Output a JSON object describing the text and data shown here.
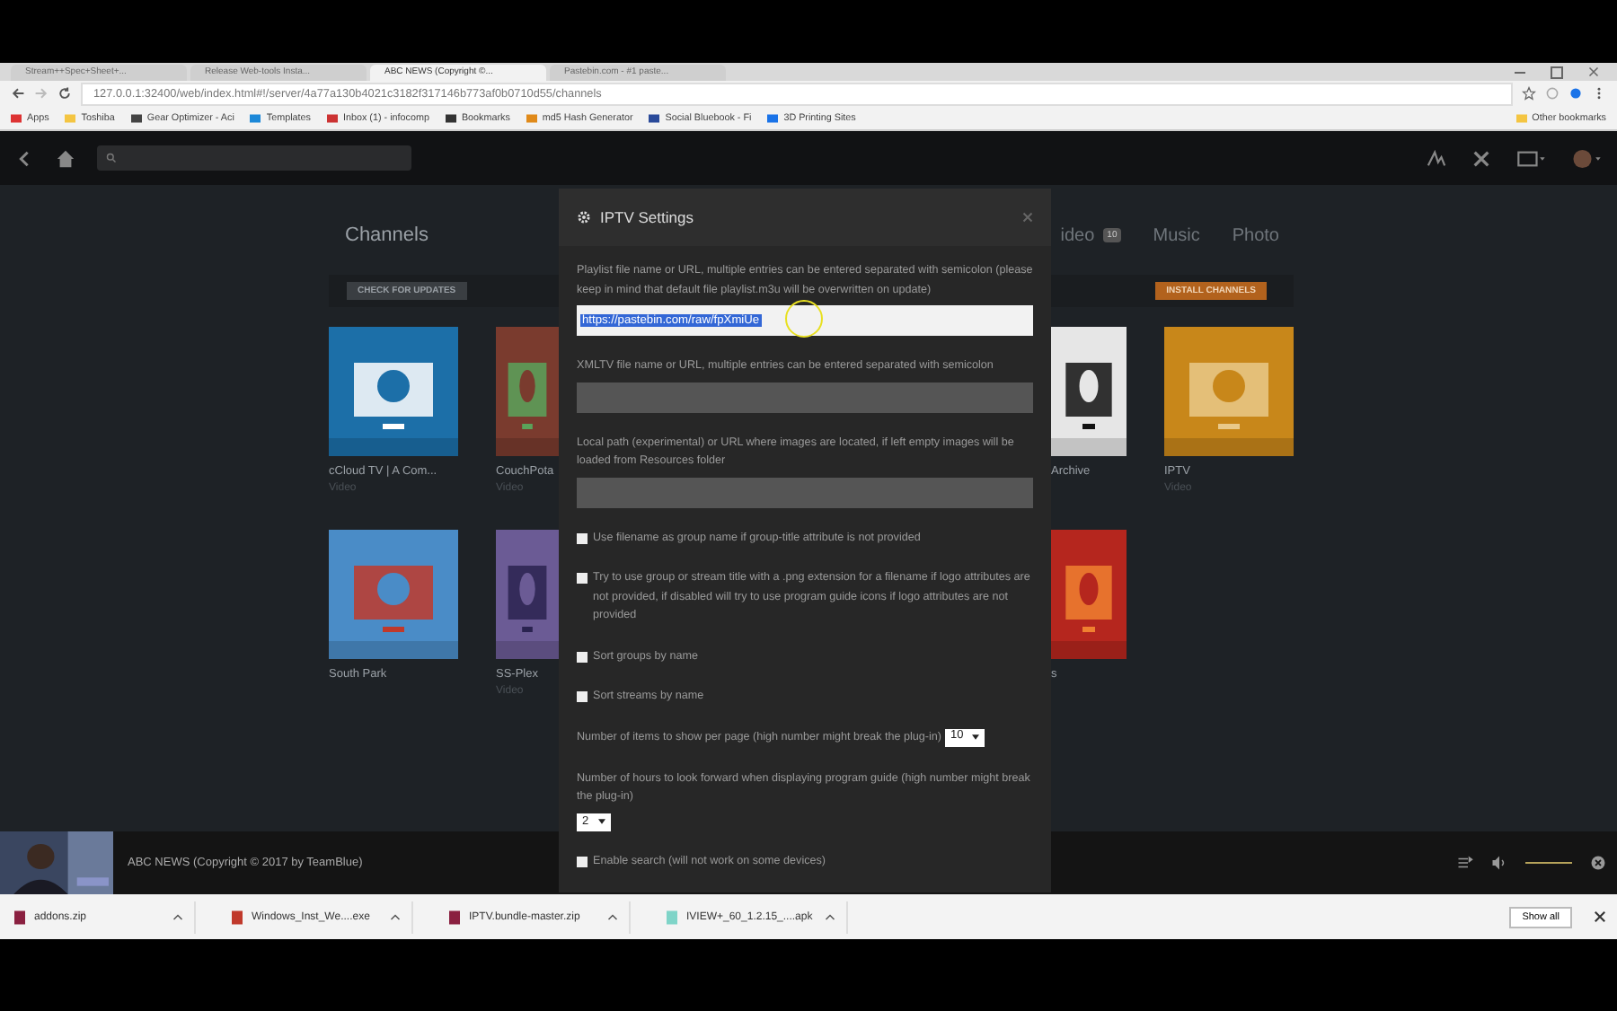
{
  "browser": {
    "tabs": [
      {
        "title": "Stream++Spec+Sheet+...",
        "selected": false
      },
      {
        "title": "Release Web-tools Insta...",
        "selected": false
      },
      {
        "title": "ABC NEWS (Copyright ©...",
        "selected": true
      },
      {
        "title": "Pastebin.com - #1 paste...",
        "selected": false
      }
    ],
    "address": "127.0.0.1:32400/web/index.html#!/server/4a77a130b4021c3182f317146b773af0b0710d55/channels",
    "bookmarks": [
      "Apps",
      "Toshiba",
      "Gear Optimizer - Aci",
      "Templates",
      "Inbox (1) - infocomp",
      "Bookmarks",
      "md5 Hash Generator",
      "Social Bluebook - Fi",
      "3D Printing Sites"
    ],
    "other_bookmarks": "Other bookmarks"
  },
  "page": {
    "title": "Channels",
    "check_button": "CHECK FOR UPDATES",
    "install_button": "INSTALL CHANNELS",
    "tabs": [
      {
        "label": "ideo",
        "badge": "10"
      },
      {
        "label": "Music"
      },
      {
        "label": "Photo"
      }
    ],
    "rows": [
      [
        {
          "name": "cCloud TV | A Com...",
          "sub": "Video"
        },
        {
          "name": "CouchPota",
          "sub": "Video"
        },
        {
          "name": "Archive"
        },
        {
          "name": "IPTV",
          "sub": "Video"
        }
      ],
      [
        {
          "name": "South Park"
        },
        {
          "name": "SS-Plex",
          "sub": "Video"
        },
        {
          "name": "s"
        }
      ]
    ]
  },
  "dialog": {
    "title": "IPTV Settings",
    "settings": [
      {
        "kind": "text",
        "label": "Playlist file name or URL, multiple entries can be entered separated with semicolon (please keep in mind that default file playlist.m3u will be overwritten on update)",
        "value": "https://pastebin.com/raw/fpXmiUe",
        "selected": true
      },
      {
        "kind": "text",
        "label": "XMLTV file name or URL, multiple entries can be entered separated with semicolon"
      },
      {
        "kind": "text",
        "label": "Local path (experimental) or URL where images are located, if left empty images will be loaded from Resources folder"
      },
      {
        "kind": "check",
        "label": "Use filename as group name if group-title attribute is not provided",
        "checked": false
      },
      {
        "kind": "check",
        "label": "Try to use group or stream title with a .png extension for a filename if logo attributes are not provided, if disabled will try to use program guide icons if logo attributes are not provided",
        "checked": false
      },
      {
        "kind": "check",
        "label": "Sort groups by name",
        "checked": false
      },
      {
        "kind": "check",
        "label": "Sort streams by name",
        "checked": false
      },
      {
        "kind": "inline_select",
        "label": "Number of items to show per page (high number might break the plug-in)",
        "value": "10"
      },
      {
        "kind": "select",
        "label": "Number of hours to look forward when displaying program guide (high number might break the plug-in)",
        "value": "2"
      },
      {
        "kind": "check",
        "label": "Enable search (will not work on some devices)",
        "checked": false
      }
    ]
  },
  "player": {
    "title": "ABC NEWS (Copyright © 2017 by TeamBlue)",
    "volume": {
      "level": 1
    }
  },
  "downloads": {
    "items": [
      "addons.zip",
      "Windows_Inst_We....exe",
      "IPTV.bundle-master.zip",
      "IVIEW+_60_1.2.15_....apk"
    ],
    "show_all": "Show all"
  }
}
